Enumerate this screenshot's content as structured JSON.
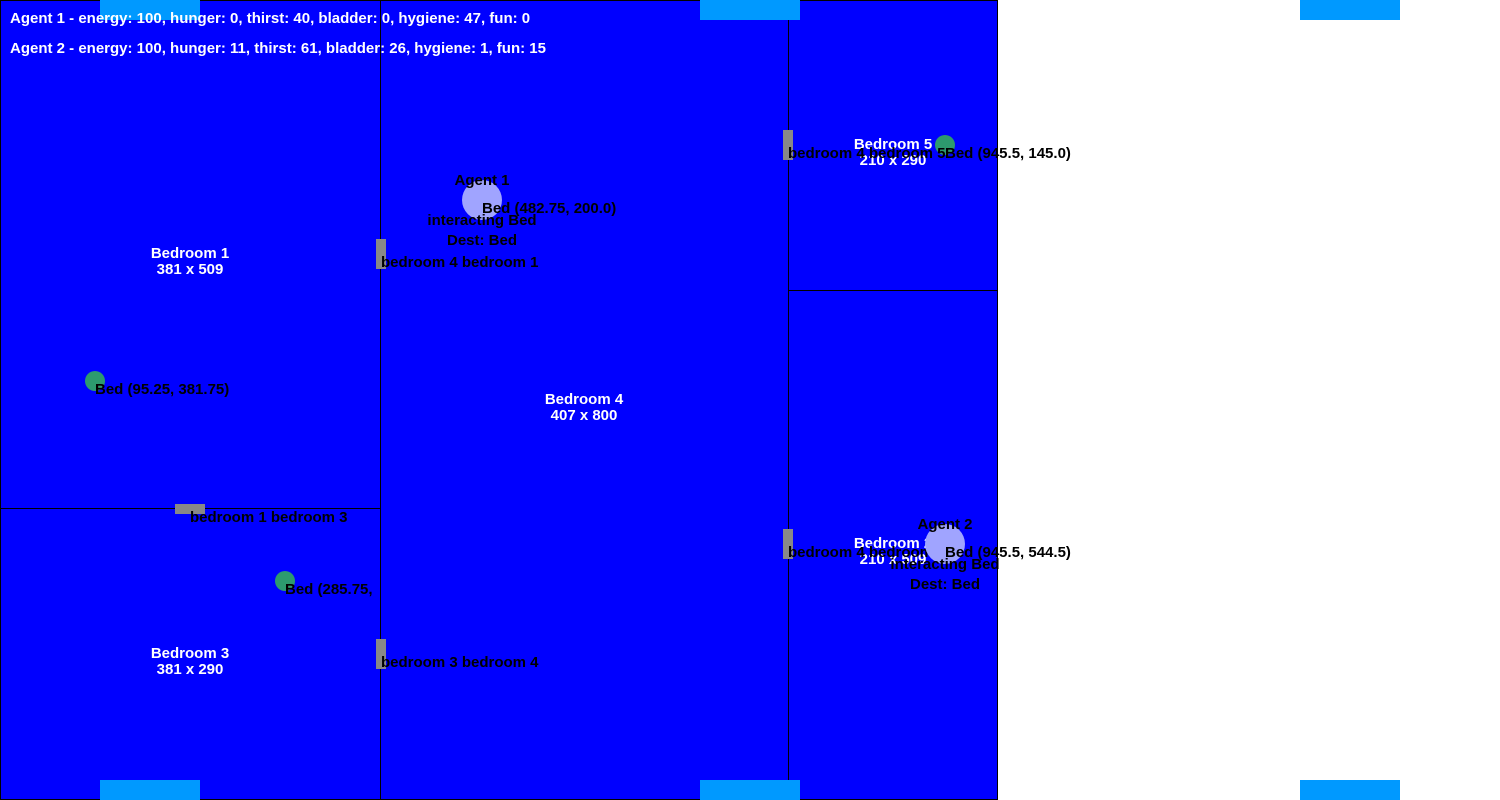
{
  "status": {
    "agent1": "Agent 1 - energy: 100, hunger: 0, thirst: 40, bladder: 0, hygiene: 47, fun: 0",
    "agent2": "Agent 2 - energy: 100, hunger: 11, thirst: 61, bladder: 26, hygiene: 1, fun: 15"
  },
  "rooms": {
    "bedroom1": {
      "name": "Bedroom 1",
      "size": "381 x 509"
    },
    "bedroom3": {
      "name": "Bedroom 3",
      "size": "381 x 290"
    },
    "bedroom4": {
      "name": "Bedroom 4",
      "size": "407 x 800"
    },
    "bedroom5": {
      "name": "Bedroom 5",
      "size": "210 x 290"
    },
    "bedroom2": {
      "name": "Bedroom 2",
      "size": "210 x 509"
    }
  },
  "doors": {
    "b1_b3": "bedroom 1 bedroom 3",
    "b4_b1": "bedroom 4 bedroom 1",
    "b3_b4": "bedroom 3 bedroom 4",
    "b4_b5": "bedroom 4 bedroom 5",
    "b4_b2": "bedroom 4 bedroom 2"
  },
  "beds": {
    "bed1": "Bed (95.25, 381.75)",
    "bed3": "Bed (285.75,",
    "bed4": "Bed (482.75, 200.0)",
    "bed5": "Bed (945.5, 145.0)",
    "bed2": "Bed (945.5, 544.5)"
  },
  "agents": {
    "agent1": {
      "name": "Agent 1",
      "state": "interacting Bed",
      "dest": "Dest: Bed"
    },
    "agent2": {
      "name": "Agent 2",
      "state": "interacting Bed",
      "dest": "Dest: Bed"
    }
  },
  "colors": {
    "room": "#0000ff",
    "window": "#0099ff",
    "door": "#888888",
    "bed": "#2d9a6e",
    "agent": "#a0a4ff"
  }
}
